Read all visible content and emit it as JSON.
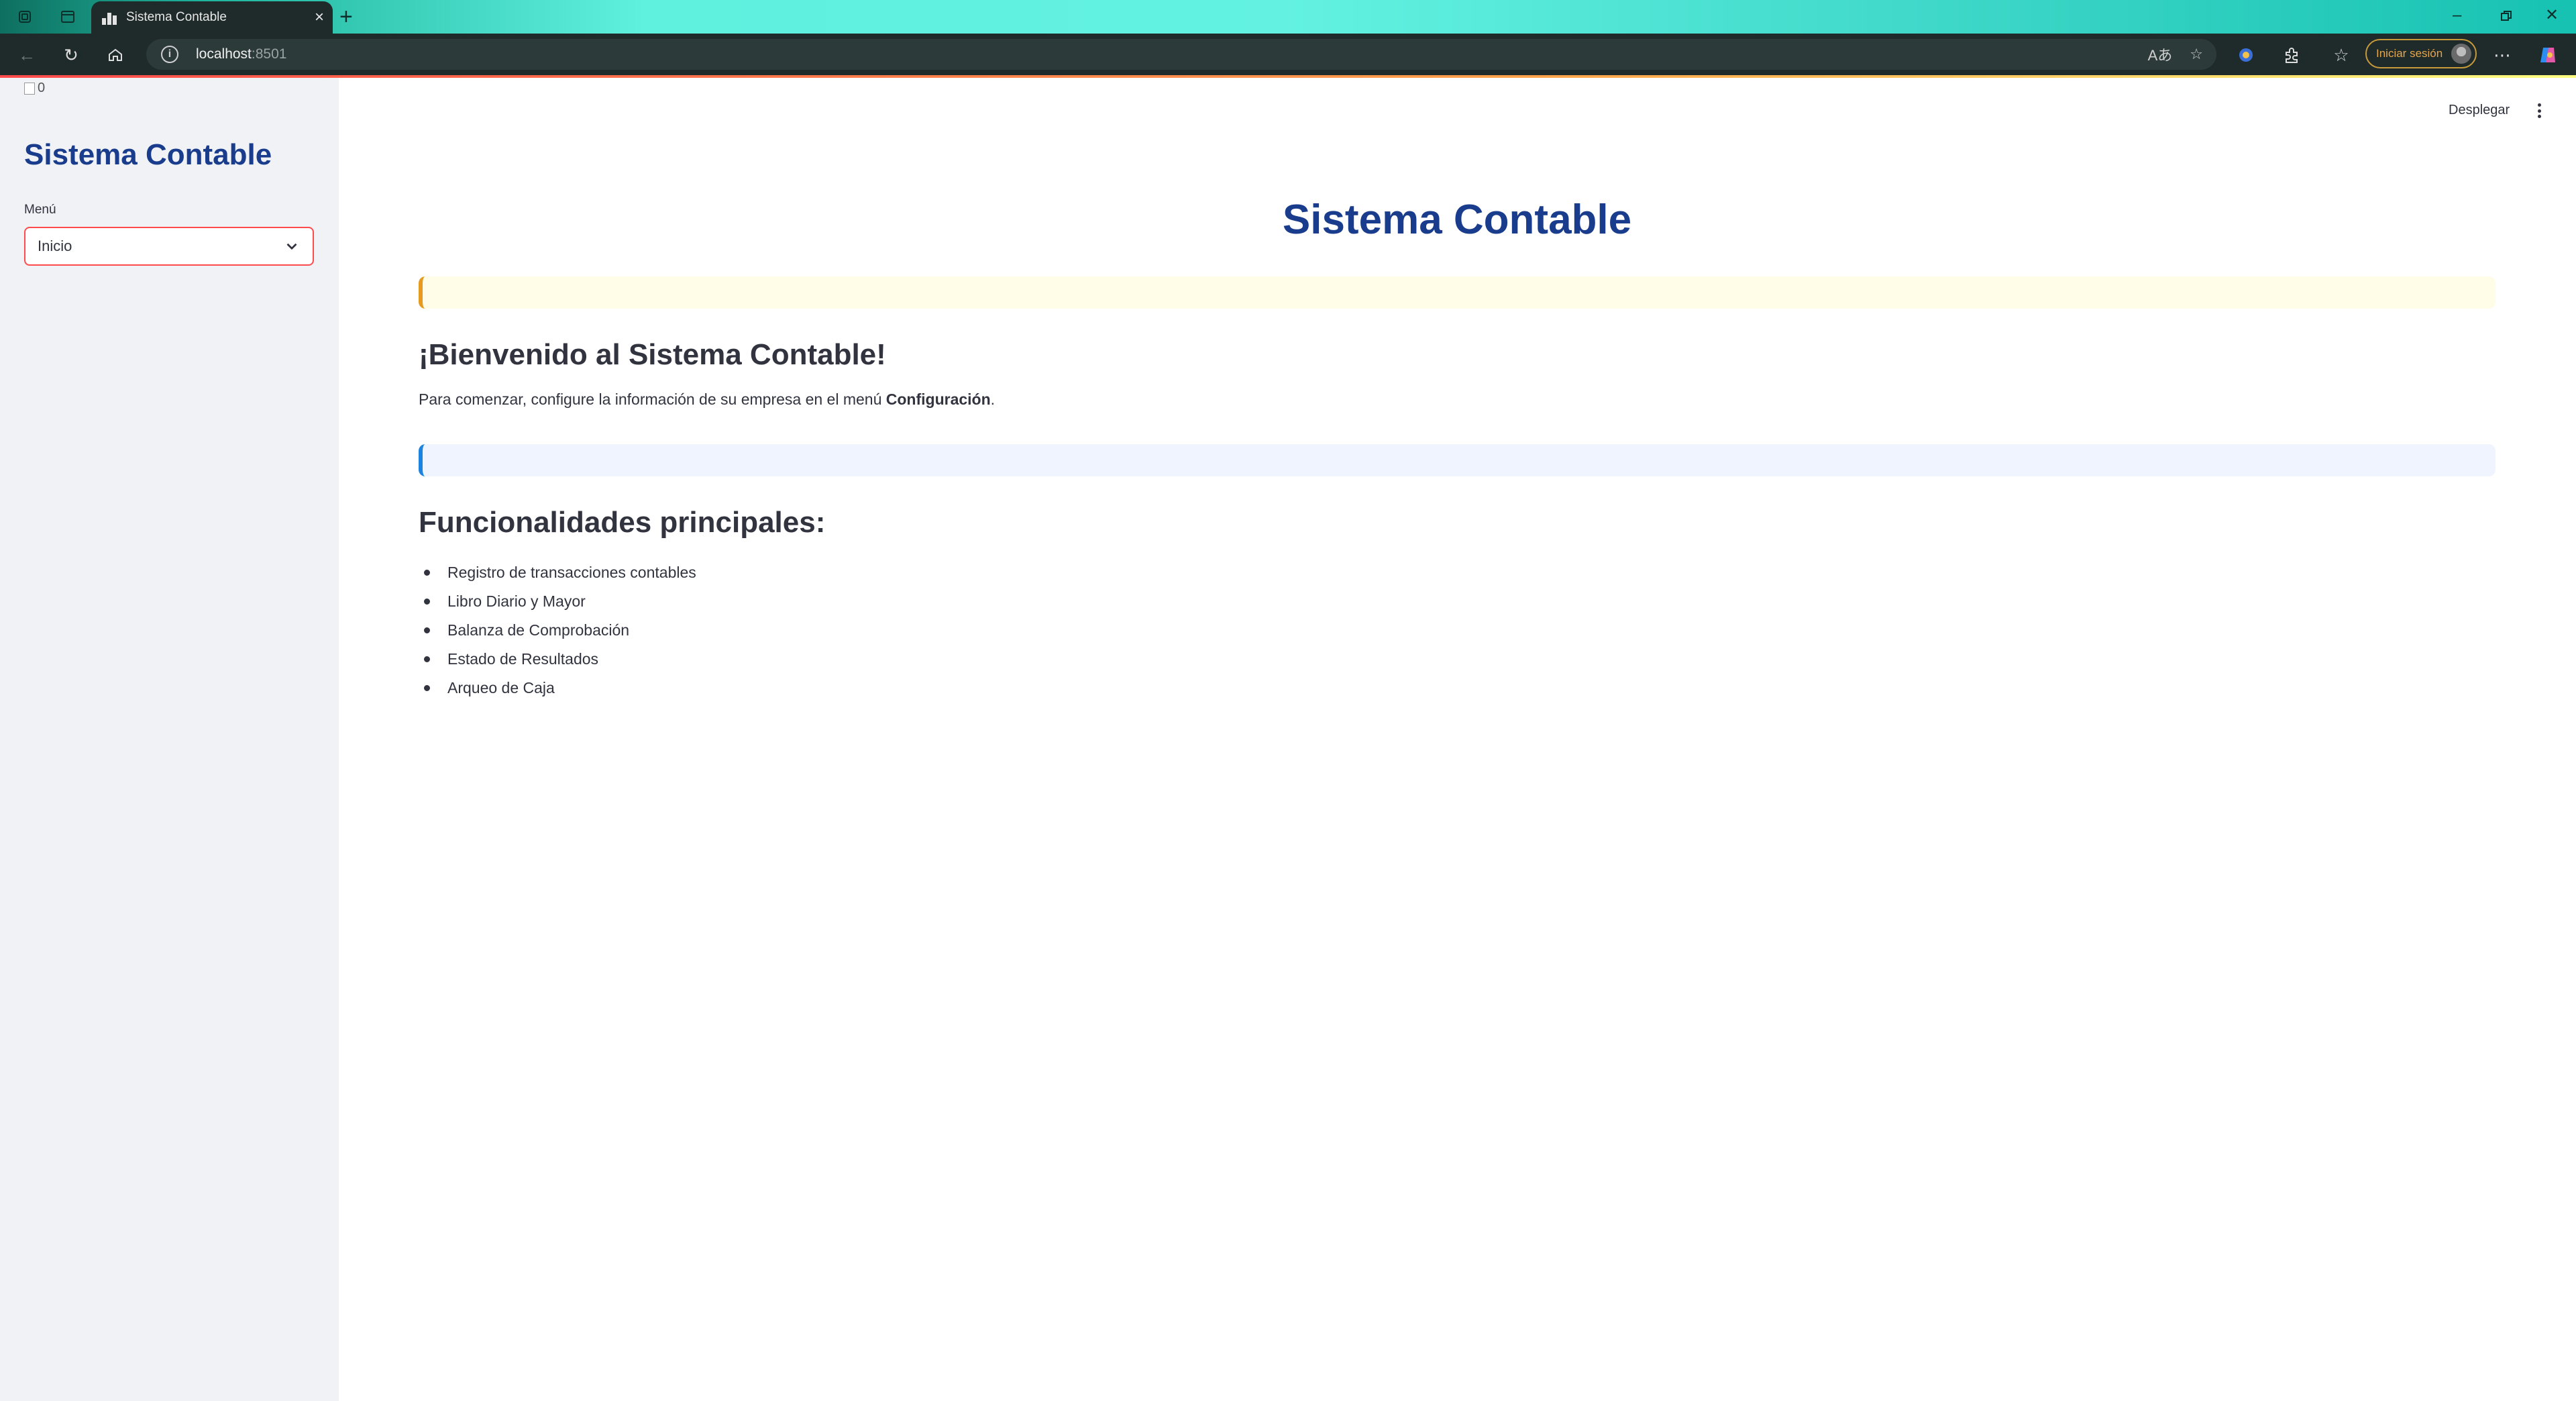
{
  "browser": {
    "tab_title": "Sistema Contable",
    "url_host": "localhost",
    "url_port": ":8501",
    "signin_label": "Iniciar sesión",
    "translate_glyph": "Aあ"
  },
  "sidebar": {
    "image_alt": "0",
    "title": "Sistema Contable",
    "menu_label": "Menú",
    "menu_selected": "Inicio"
  },
  "header": {
    "deploy_label": "Desplegar"
  },
  "main": {
    "title": "Sistema Contable",
    "welcome_heading": "¡Bienvenido al Sistema Contable!",
    "intro_text": "Para comenzar, configure la información de su empresa en el menú ",
    "intro_bold": "Configuración",
    "intro_end": ".",
    "features_heading": "Funcionalidades principales:",
    "features": [
      "Registro de transacciones contables",
      "Libro Diario y Mayor",
      "Balanza de Comprobación",
      "Estado de Resultados",
      "Arqueo de Caja"
    ]
  },
  "colors": {
    "accent_blue": "#1a3c8c",
    "streamlit_red": "#ff4b4b",
    "warning_border": "#e69a1f",
    "info_border": "#1c83e1"
  }
}
